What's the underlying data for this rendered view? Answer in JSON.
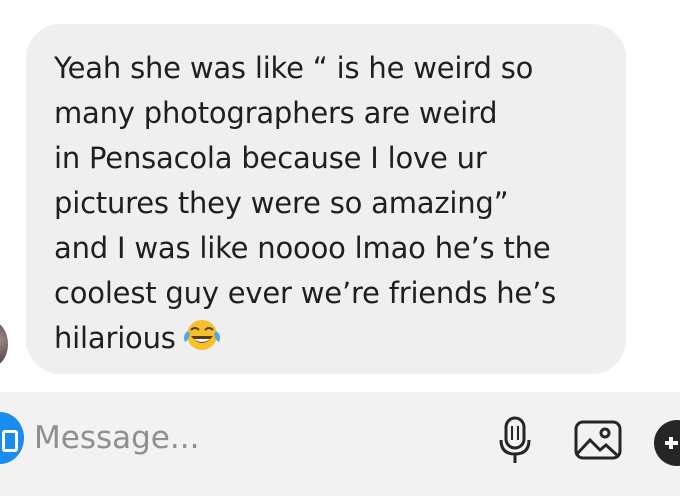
{
  "message": {
    "text": "Yeah she was like “ is he weird so\nmany photographers are weird\nin Pensacola because I love ur\npictures they were so amazing”\nand I was like noooo lmao he’s the\ncoolest guy ever we’re friends he’s\nhilarious",
    "emoji": "face-with-tears-of-joy-icon"
  },
  "composer": {
    "placeholder": "Message..."
  },
  "colors": {
    "bubble": "#efefef",
    "composer": "#f2f2f2",
    "camera": "#1a8cf0"
  }
}
